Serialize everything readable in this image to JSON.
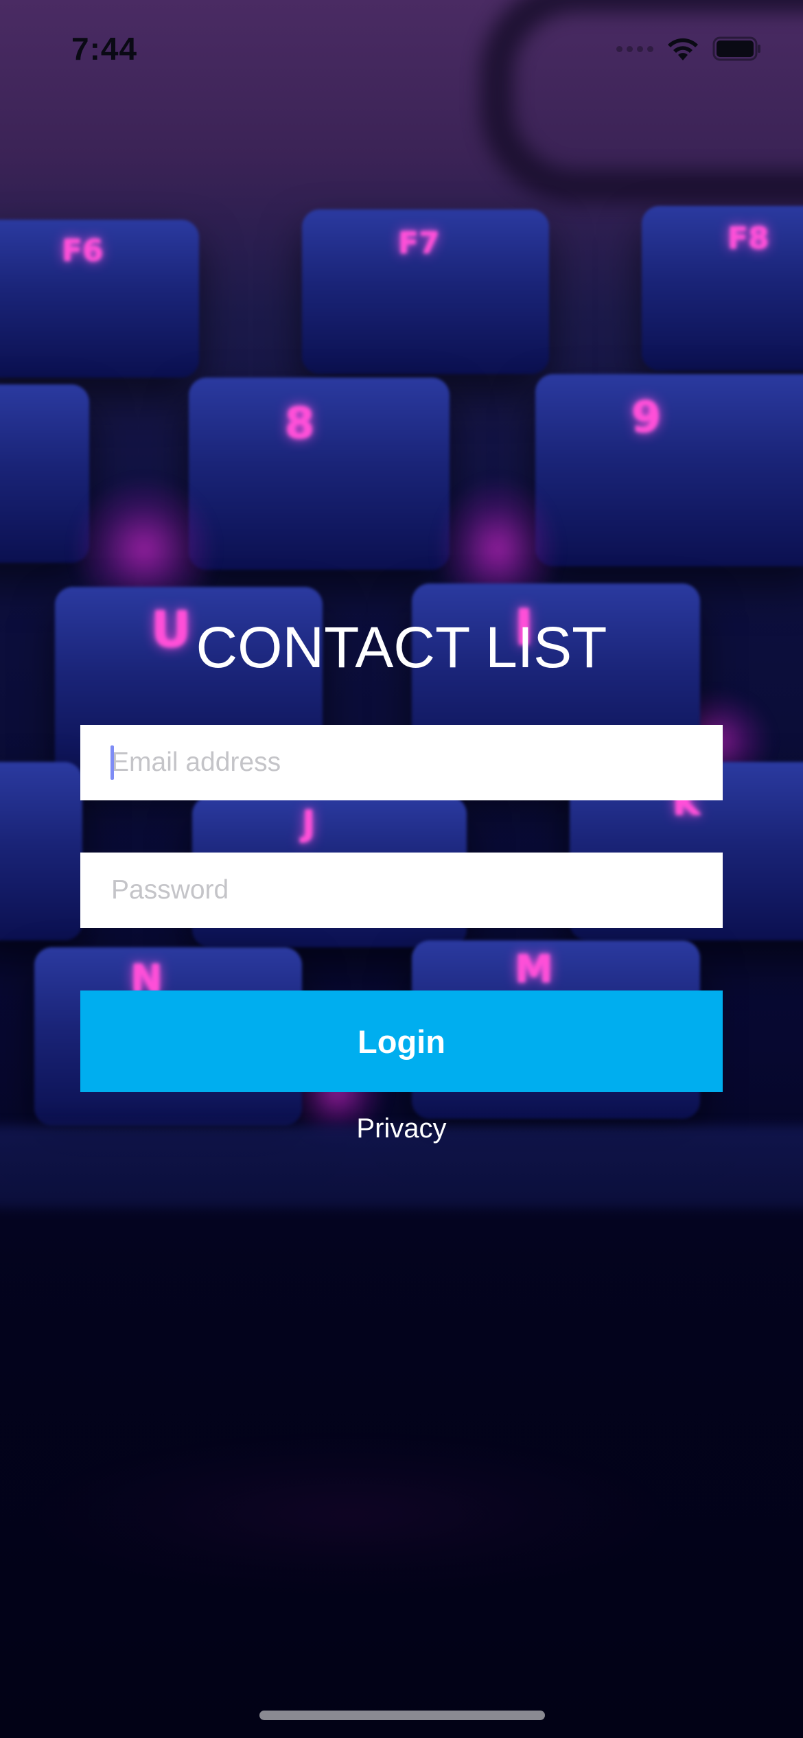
{
  "status_bar": {
    "time": "7:44",
    "icons": [
      "signal-icon",
      "wifi-icon",
      "battery-icon"
    ]
  },
  "background": {
    "key_legends": [
      "F6",
      "F7",
      "F8",
      "8",
      "9",
      "U",
      "I",
      "J",
      "K",
      "N",
      "M"
    ]
  },
  "login": {
    "title": "CONTACT LIST",
    "email_placeholder": "Email address",
    "email_value": "",
    "password_placeholder": "Password",
    "password_value": "",
    "login_label": "Login",
    "privacy_label": "Privacy"
  },
  "colors": {
    "login_button": "#00aeef",
    "field_background": "#ffffff",
    "title_text": "#ffffff"
  }
}
